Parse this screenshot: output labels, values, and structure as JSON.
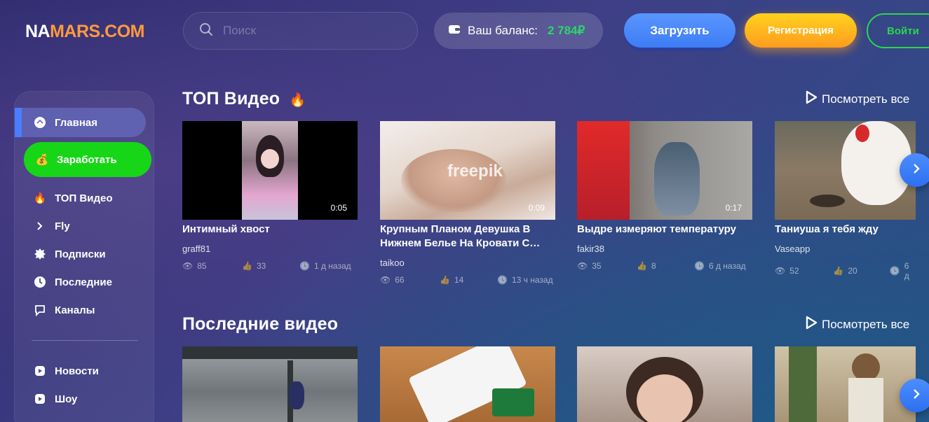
{
  "header": {
    "logo_part1": "NA",
    "logo_part2": "MARS",
    "logo_part3": ".COM",
    "search_placeholder": "Поиск",
    "balance_label": "Ваш баланс:",
    "balance_amount": "2 784₽",
    "upload_label": "Загрузить",
    "register_label": "Регистрация",
    "login_label": "Войти"
  },
  "sidebar": {
    "items": [
      {
        "label": "Главная",
        "icon": "home-icon"
      },
      {
        "label": "Заработать",
        "icon": "money-bag-icon"
      },
      {
        "label": "ТОП Видео",
        "icon": "fire-icon"
      },
      {
        "label": "Fly",
        "icon": "chevron-right-icon"
      },
      {
        "label": "Подписки",
        "icon": "subscriptions-icon"
      },
      {
        "label": "Последние",
        "icon": "clock-icon"
      },
      {
        "label": "Каналы",
        "icon": "channels-icon"
      },
      {
        "label": "Новости",
        "icon": "play-square-icon"
      },
      {
        "label": "Шоу",
        "icon": "play-square-icon"
      }
    ]
  },
  "sections": {
    "top": {
      "title": "ТОП Видео",
      "see_all": "Посмотреть все",
      "videos": [
        {
          "title": "Интимный хвост",
          "author": "graff81",
          "views": "85",
          "likes": "33",
          "time": "1 д назад",
          "duration": "0:05"
        },
        {
          "title": "Крупным Планом Девушка В Нижнем Белье На Кровати С…",
          "author": "taikoo",
          "views": "66",
          "likes": "14",
          "time": "13 ч назад",
          "duration": "0:09",
          "watermark": "freepik"
        },
        {
          "title": "Выдре измеряют температуру",
          "author": "fakir38",
          "views": "35",
          "likes": "8",
          "time": "6 д назад",
          "duration": "0:17"
        },
        {
          "title": "Таниуша я тебя жду",
          "author": "Vaseapp",
          "views": "52",
          "likes": "20",
          "time": "6 д",
          "duration": ""
        }
      ]
    },
    "latest": {
      "title": "Последние видео",
      "see_all": "Посмотреть все"
    }
  },
  "colors": {
    "accent_blue": "#4a7dff",
    "earn_green": "#17d617",
    "balance_green": "#2bd66b",
    "logo_orange": "#ff9a3c"
  }
}
